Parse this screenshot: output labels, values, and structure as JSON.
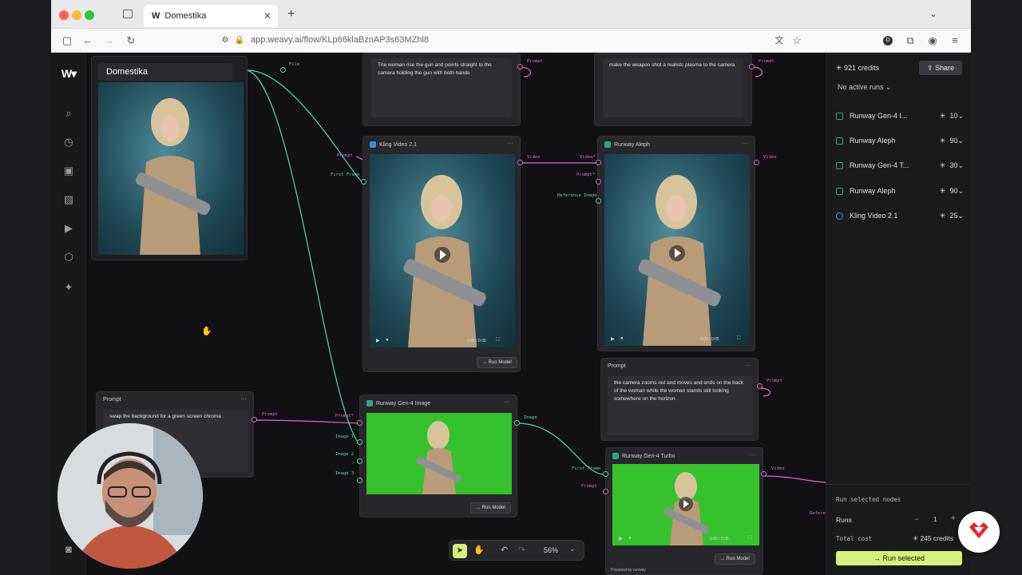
{
  "browser": {
    "tab_title": "Domestika",
    "url": "app.weavy.ai/flow/KLp66klaBznAP3s63MZhl8"
  },
  "canvas": {
    "image_node": {
      "title": "Domestika",
      "port_label": "File"
    },
    "prompt_top_1": {
      "text": "The woman rise the gun and points straight  to the camera holding the gun with both hands",
      "port_label": "Prompt"
    },
    "prompt_top_2": {
      "text": "make the weapon shot a realistc plasma to the camera",
      "port_label": "Prompt"
    },
    "kling_node": {
      "title": "Kling Video 2.1",
      "in_prompt": "Prompt",
      "in_first": "First Frame",
      "out_label": "Video",
      "time": "0:00 / 0:05",
      "run": "→ Run Model"
    },
    "aleph_node": {
      "title": "Runway Aleph",
      "in_video": "Video*",
      "in_prompt": "Prompt*",
      "in_ref": "Reference Image",
      "out_label": "Video",
      "time": "0:00 / 0:05"
    },
    "prompt_mid": {
      "title": "Prompt",
      "text": "the camera zooms out and moves and ends on the back of the woman while the woman stands still looking somewhere on the horizon",
      "port_label": "Prompt"
    },
    "prompt_left": {
      "title": "Prompt",
      "text": "swap the background for a green screen chroma",
      "port_label": "Prompt"
    },
    "gen4image_node": {
      "title": "Runway Gen-4 Image",
      "in_prompt": "Prompt*",
      "in_img1": "Image 1",
      "in_img2": "Image 2",
      "in_img3": "Image 3",
      "out_label": "Image",
      "run": "→ Run Model"
    },
    "gen4turbo_node": {
      "title": "Runway Gen-4 Turbo",
      "in_first": "First Frame",
      "in_prompt": "Prompt",
      "out_label": "Video",
      "time": "0:00 / 0:05",
      "run": "→ Run Model",
      "powered": "Powered by runway"
    },
    "offscreen_label": "Refere",
    "zoom": "56%"
  },
  "right_panel": {
    "credits": "921 credits",
    "share": "Share",
    "no_runs": "No active runs",
    "models": [
      {
        "name": "Runway Gen-4 I...",
        "cost": "10"
      },
      {
        "name": "Runway Aleph",
        "cost": "90"
      },
      {
        "name": "Runway Gen-4 T...",
        "cost": "30"
      },
      {
        "name": "Runway Aleph",
        "cost": "90"
      },
      {
        "name": "Kling Video 2.1",
        "cost": "25"
      }
    ],
    "run_selected_nodes": "Run selected nodes",
    "runs_label": "Runs",
    "runs_value": "1",
    "total_cost_label": "Total cost",
    "total_cost_value": "245 credits",
    "run_button": "→ Run selected"
  },
  "colors": {
    "accent_green": "#5fd1b4",
    "accent_pink": "#d86bd2",
    "run_btn": "#d6f07a",
    "brand": "#2ea77f"
  }
}
